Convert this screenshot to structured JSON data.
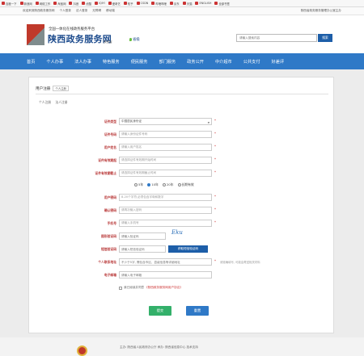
{
  "bookmarks": [
    "百度一下",
    "新浪网",
    "网络工作",
    "淘宝网",
    "抖音",
    "优酷",
    "iQIYI",
    "爱奇艺",
    "知乎",
    "CSDN",
    "哔哩哔哩",
    "京东",
    "天猫",
    "ENGLISH",
    "全部书签"
  ],
  "topbar": {
    "left": [
      "欢迎来到陕西政务服务网",
      "个人登录",
      "法人登录",
      "无障碍",
      "移动端"
    ],
    "right": "陕西省政务服务管理办公室主办"
  },
  "header": {
    "subtitle": "全国一体化在线政务服务平台",
    "title": "陕西政务服务网",
    "small": "陕西省",
    "location": "省级"
  },
  "search": {
    "placeholder": "请输入搜索内容",
    "button": "搜索"
  },
  "nav": [
    "首页",
    "个人办事",
    "法人办事",
    "特色服务",
    "便民服务",
    "部门服务",
    "政务公开",
    "中介超市",
    "公共支付",
    "好差评"
  ],
  "form": {
    "panel_title": "用户注册",
    "panel_tag": "个人注册",
    "breadcrumb": [
      "个人注册",
      "法人注册"
    ],
    "fields": [
      {
        "label": "证件类型",
        "value": "中国居民身份证",
        "kind": "select"
      },
      {
        "label": "证件号码",
        "value": "请输入身份证件号码",
        "kind": "input"
      },
      {
        "label": "用户姓名",
        "value": "请输入用户姓名",
        "kind": "input"
      },
      {
        "label": "证件有效期起",
        "value": "请选择证件有效期开始时间",
        "kind": "input"
      },
      {
        "label": "证件有效期截止",
        "value": "请选择证件有效期截止时间",
        "kind": "input"
      }
    ],
    "validity_options": [
      "5年",
      "10年",
      "20年",
      "长期有效"
    ],
    "fields2": [
      {
        "label": "用户密码",
        "value": "8-20个字符,必须包含字母和数字",
        "kind": "input"
      },
      {
        "label": "确认密码",
        "value": "请再次输入密码",
        "kind": "input"
      },
      {
        "label": "手机号",
        "value": "请输入手机号",
        "kind": "input"
      }
    ],
    "captcha_label": "图形验证码",
    "captcha_placeholder": "请输入验证码",
    "captcha_text": "Eku",
    "sms_label": "短信验证码",
    "sms_placeholder": "请输入短信验证码",
    "sms_button": "获取短信验证码",
    "address_label": "个人联系地址",
    "address_placeholder": "不少于5字, 需包含市区、县级信息等详细地址",
    "address_hint": "请准确填写, 可能会寄送相关材料",
    "email_label": "电子邮箱",
    "email_placeholder": "请输入电子邮箱",
    "agree_text": "我已阅读并同意",
    "agree_link": "《陕西政务服务网用户协议》",
    "submit": "提交",
    "reset": "重置"
  },
  "footer": {
    "text": "主办: 陕西省人民政府办公厅  承办: 陕西省信息中心  技术支持"
  }
}
